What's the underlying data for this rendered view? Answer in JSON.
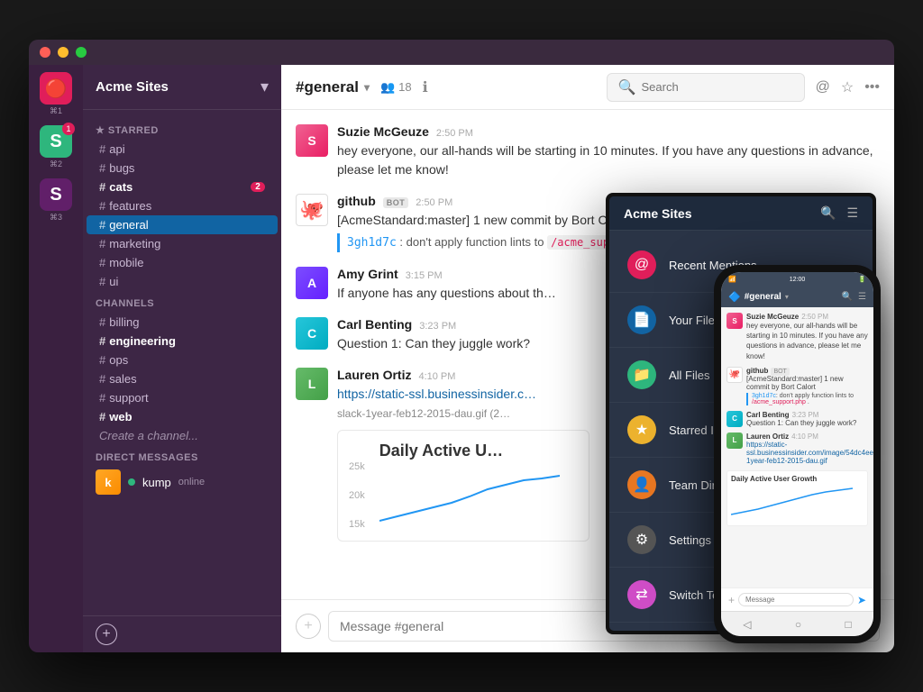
{
  "window": {
    "traffic_lights": [
      "red",
      "yellow",
      "green"
    ]
  },
  "sidebar": {
    "workspace_name": "Acme Sites",
    "chevron": "▾",
    "team_icons": [
      {
        "id": "t1",
        "label": "⌘1",
        "icon": "🔴",
        "active": true
      },
      {
        "id": "t2",
        "label": "⌘2",
        "icon": "S",
        "active": false,
        "badge": "1"
      },
      {
        "id": "t3",
        "label": "⌘3",
        "icon": "S",
        "active": false
      }
    ],
    "starred_label": "★ STARRED",
    "starred_items": [
      {
        "name": "api",
        "prefix": "#",
        "bold": false
      },
      {
        "name": "bugs",
        "prefix": "#",
        "bold": false
      },
      {
        "name": "cats",
        "prefix": "#",
        "bold": true,
        "badge": "2"
      },
      {
        "name": "features",
        "prefix": "#",
        "bold": false
      },
      {
        "name": "general",
        "prefix": "#",
        "bold": false,
        "active": true
      },
      {
        "name": "marketing",
        "prefix": "#",
        "bold": false
      },
      {
        "name": "mobile",
        "prefix": "#",
        "bold": false
      },
      {
        "name": "ui",
        "prefix": "#",
        "bold": false
      }
    ],
    "channels_label": "CHANNELS",
    "channels": [
      {
        "name": "billing",
        "prefix": "#"
      },
      {
        "name": "engineering",
        "prefix": "#",
        "bold": true
      },
      {
        "name": "ops",
        "prefix": "#"
      },
      {
        "name": "sales",
        "prefix": "#"
      },
      {
        "name": "support",
        "prefix": "#"
      },
      {
        "name": "web",
        "prefix": "#",
        "bold": true
      }
    ],
    "create_channel": "Create a channel...",
    "dm_label": "DIRECT MESSAGES",
    "dm_user": "kump",
    "dm_status": "online",
    "add_label": "+"
  },
  "chat": {
    "channel_name": "#general",
    "member_count": "18",
    "search_placeholder": "Search",
    "messages": [
      {
        "author": "Suzie McGeuze",
        "time": "2:50 PM",
        "text": "hey everyone, our all-hands will be starting in 10 minutes. If you have any questions in advance, please let me know!",
        "avatar_initial": "S",
        "avatar_class": "avatar-suzie"
      },
      {
        "author": "github",
        "time": "2:50 PM",
        "is_bot": true,
        "bot_label": "BOT",
        "text": "[AcmeStandard:master] 1 new commit by Bort Calort",
        "commit_hash": "3gh1d7c",
        "commit_text": ": don't apply function lints to ",
        "commit_file": "/acme_support.php",
        "avatar_class": "avatar-github",
        "is_github": true
      },
      {
        "author": "Amy Grint",
        "time": "3:15 PM",
        "text": "If anyone has any questions about th…",
        "avatar_initial": "A",
        "avatar_class": "avatar-amy"
      },
      {
        "author": "Carl Benting",
        "time": "3:23 PM",
        "text": "Question 1: Can they juggle work?",
        "avatar_initial": "C",
        "avatar_class": "avatar-carl"
      },
      {
        "author": "Lauren Ortiz",
        "time": "4:10 PM",
        "link": "https://static-ssl.businessinsider.com/image/54dc4ee369bedd4775ef2753/slack-1year-feb12-2015-dau.gif",
        "link_short": "https://static-ssl.businessinsider.c…",
        "link_short2": "slack-1year-feb12-2015-dau.gif (2…",
        "avatar_initial": "L",
        "avatar_class": "avatar-lauren"
      }
    ],
    "chart_title": "Daily Active U…",
    "chart_labels": [
      "25k",
      "20k",
      "15k"
    ]
  },
  "tablet": {
    "title": "Acme Sites",
    "menu_items": [
      {
        "label": "Recent Mentions",
        "icon": "@",
        "icon_class": "icon-red"
      },
      {
        "label": "Your Files",
        "icon": "📄",
        "icon_class": "icon-blue"
      },
      {
        "label": "All Files",
        "icon": "📁",
        "icon_class": "icon-green"
      },
      {
        "label": "Starred Items",
        "icon": "★",
        "icon_class": "icon-yellow"
      },
      {
        "label": "Team Directory",
        "icon": "👤",
        "icon_class": "icon-orange"
      },
      {
        "label": "Settings",
        "icon": "⚙",
        "icon_class": "icon-gray"
      },
      {
        "label": "Switch Teams",
        "icon": "⇄",
        "icon_class": "icon-pink"
      }
    ]
  },
  "phone": {
    "channel": "#general",
    "status_time": "12:00",
    "messages": [
      {
        "author": "Suzie McGeuze",
        "time": "2:50 PM",
        "text": "hey everyone, our all-hands will be starting in 10 minutes. If you have any questions in advance, please let me know!"
      },
      {
        "author": "github",
        "time": "BOT",
        "text": "[AcmeStandard:master] 1 new commit by Bort Calort",
        "is_commit": true,
        "commit_hash": "3gh1d7c",
        "commit_rest": ": don't apply function lints to ",
        "commit_file": "/acme_support.php ."
      },
      {
        "author": "Carl Benting",
        "time": "3:23 PM",
        "text": "Question 1: Can they juggle work?"
      },
      {
        "author": "Lauren Ortiz",
        "time": "4:10 PM",
        "is_link": true,
        "link": "https://static-ssl.businessinsider.com/image/54dc4ee369bedd4775ef2753/slack-1year-feb12-2015-dau.gif"
      }
    ],
    "chart_label": "Daily Active User Growth",
    "input_placeholder": "Message",
    "nav_items": [
      "◁",
      "○",
      "□"
    ]
  }
}
